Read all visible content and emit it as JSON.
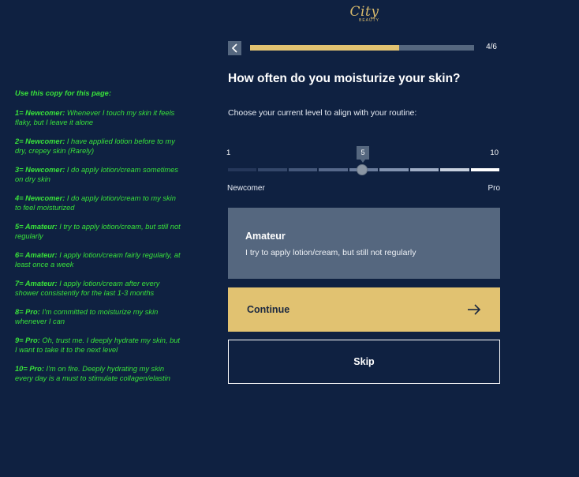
{
  "brand": {
    "logo_text": "City",
    "logo_sub": "BEAUTY"
  },
  "notes": {
    "heading": "Use this copy for this page:",
    "items": [
      {
        "level": "1= Newcomer:",
        "text": " Whenever I touch my skin it feels flaky, but I leave it alone"
      },
      {
        "level": "2= Newcomer:",
        "text": " I have applied lotion before to my dry, crepey skin (Rarely)"
      },
      {
        "level": "3= Newcomer:",
        "text": " I do apply lotion/cream sometimes on dry skin"
      },
      {
        "level": "4= Newcomer:",
        "text": " I do apply lotion/cream to my skin to feel moisturized"
      },
      {
        "level": "5= Amateur:",
        "text": " I try to apply lotion/cream, but still not regularly"
      },
      {
        "level": "6= Amateur:",
        "text": " I apply lotion/cream fairly regularly, at least once a week"
      },
      {
        "level": "7= Amateur:",
        "text": " I apply lotion/cream after every shower consistently for the last 1-3 months"
      },
      {
        "level": "8= Pro:",
        "text": " I'm committed to moisturize my skin whenever I can"
      },
      {
        "level": "9= Pro:",
        "text": " Oh, trust me. I deeply hydrate my skin, but I want to take it to the next level"
      },
      {
        "level": "10= Pro:",
        "text": " I'm on fire. Deeply hydrating my skin every day is a must to stimulate collagen/elastin"
      }
    ]
  },
  "progress": {
    "step_label": "4/6",
    "fraction": 0.667
  },
  "question": "How often do you moisturize your skin?",
  "instruction": "Choose your current level to align with your routine:",
  "slider": {
    "min_label": "1",
    "max_label": "10",
    "value": 5,
    "value_label": "5",
    "left_caption": "Newcomer",
    "right_caption": "Pro"
  },
  "selected_level": {
    "title": "Amateur",
    "description": "I try to apply lotion/cream, but still not regularly"
  },
  "buttons": {
    "continue": "Continue",
    "skip": "Skip"
  },
  "colors": {
    "background": "#0f2141",
    "accent": "#e1c271",
    "card": "#55677f",
    "note_text": "#39e23a"
  },
  "icons": {
    "back": "chevron-left-icon",
    "continue": "arrow-right-icon"
  }
}
